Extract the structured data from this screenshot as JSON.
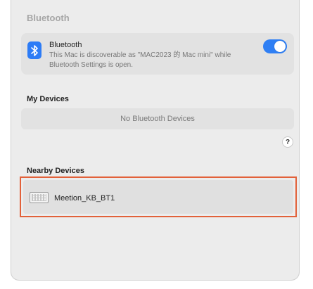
{
  "header": {
    "title": "Bluetooth"
  },
  "bluetooth": {
    "title": "Bluetooth",
    "description": "This Mac is discoverable as \"MAC2023 的 Mac mini\" while Bluetooth Settings is open.",
    "enabled": true,
    "accent_color": "#2f7ff4",
    "icon": "bluetooth-icon"
  },
  "my_devices": {
    "title": "My Devices",
    "empty_text": "No Bluetooth Devices"
  },
  "help": {
    "label": "?"
  },
  "nearby": {
    "title": "Nearby Devices",
    "devices": [
      {
        "name": "Meetion_KB_BT1",
        "icon": "keyboard-icon"
      }
    ],
    "highlight_color": "#e2613a"
  }
}
